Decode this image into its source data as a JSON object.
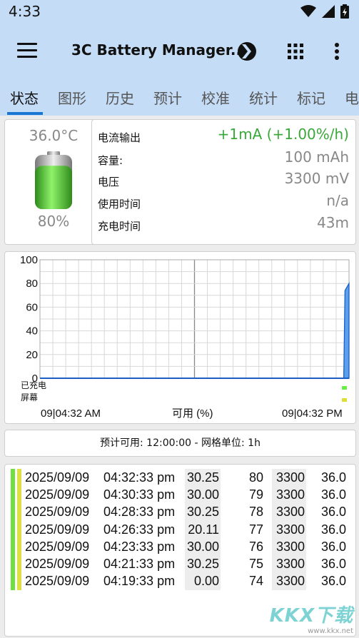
{
  "status_bar": {
    "time": "4:33"
  },
  "app_bar": {
    "title": "3C Battery Manager..."
  },
  "tabs": [
    {
      "label": "状态"
    },
    {
      "label": "图形"
    },
    {
      "label": "历史"
    },
    {
      "label": "预计"
    },
    {
      "label": "校准"
    },
    {
      "label": "统计"
    },
    {
      "label": "标记"
    },
    {
      "label": "电"
    }
  ],
  "battery": {
    "temperature": "36.0°C",
    "percent": "80%"
  },
  "info": {
    "current_label": "电流输出",
    "current_value": "+1mA (+1.00%/h)",
    "capacity_label": "容量:",
    "capacity_value": "100 mAh",
    "voltage_label": "电压",
    "voltage_value": "3300 mV",
    "usage_label": "使用时间",
    "usage_value": "n/a",
    "charge_label": "充电时间",
    "charge_value": "43m"
  },
  "chart_data": {
    "type": "area",
    "yticks": [
      "100",
      "80",
      "60",
      "40",
      "20",
      "0"
    ],
    "ylim": [
      0,
      100
    ],
    "x_start": "09|04:32 AM",
    "x_end": "09|04:32 PM",
    "xlabel": "可用 (%)",
    "rows": [
      "已充电",
      "屏幕"
    ],
    "series": [
      {
        "x": [
          "04:32 AM",
          "04:19 PM",
          "04:21 PM",
          "04:32 PM"
        ],
        "values": [
          0,
          0,
          74,
          80
        ]
      }
    ],
    "grid": true
  },
  "forecast": {
    "text": "预计可用:  12:00:00 - 网格单位:  1h"
  },
  "log": [
    {
      "date": "2025/09/09",
      "time": "04:32:33 pm",
      "pct": "30.25",
      "level": "80",
      "mv": "3300",
      "temp": "36.0"
    },
    {
      "date": "2025/09/09",
      "time": "04:30:33 pm",
      "pct": "30.00",
      "level": "79",
      "mv": "3300",
      "temp": "36.0"
    },
    {
      "date": "2025/09/09",
      "time": "04:28:33 pm",
      "pct": "30.25",
      "level": "78",
      "mv": "3300",
      "temp": "36.0"
    },
    {
      "date": "2025/09/09",
      "time": "04:26:33 pm",
      "pct": "20.11",
      "level": "77",
      "mv": "3300",
      "temp": "36.0"
    },
    {
      "date": "2025/09/09",
      "time": "04:23:33 pm",
      "pct": "30.00",
      "level": "76",
      "mv": "3300",
      "temp": "36.0"
    },
    {
      "date": "2025/09/09",
      "time": "04:21:33 pm",
      "pct": "30.25",
      "level": "75",
      "mv": "3300",
      "temp": "36.0"
    },
    {
      "date": "2025/09/09",
      "time": "04:19:33 pm",
      "pct": "0.00",
      "level": "74",
      "mv": "3300",
      "temp": "36.0"
    }
  ],
  "colors": {
    "accent": "#1976d2",
    "bar": "#c5dcf6",
    "positive": "#3aa83a",
    "battery": "#6fe040"
  },
  "watermark": {
    "text": "KKX下载",
    "url": "www.kkx.net"
  }
}
